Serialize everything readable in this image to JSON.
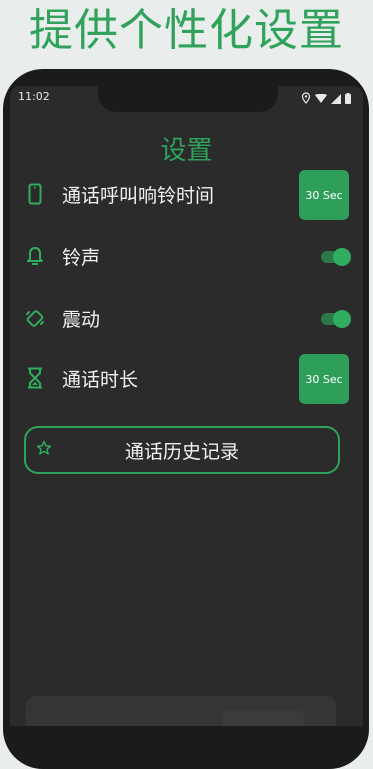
{
  "banner": {
    "title": "提供个性化设置"
  },
  "status_bar": {
    "time": "11:02"
  },
  "settings": {
    "title": "设置",
    "items": [
      {
        "icon": "phone-icon",
        "label": "通话呼叫响铃时间",
        "value": "30 Sec",
        "control": "button"
      },
      {
        "icon": "bell-icon",
        "label": "铃声",
        "control": "toggle",
        "on": true
      },
      {
        "icon": "vibrate-icon",
        "label": "震动",
        "control": "toggle",
        "on": true
      },
      {
        "icon": "hourglass-icon",
        "label": "通话时长",
        "value": "30 Sec",
        "control": "button"
      }
    ],
    "history_button": {
      "icon": "star-icon",
      "label": "通话历史记录"
    }
  },
  "colors": {
    "accent": "#2e9f58",
    "background": "#2b2b2b",
    "text": "#f2f2f2"
  }
}
